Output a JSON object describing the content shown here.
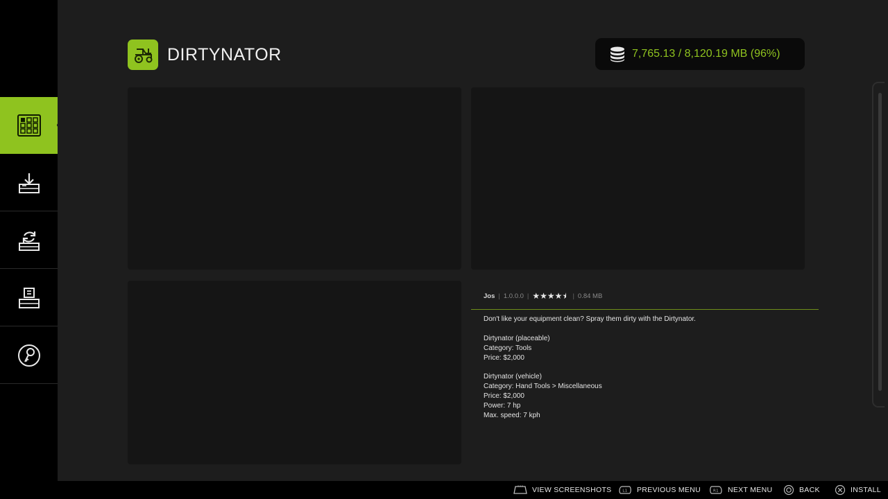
{
  "header": {
    "title": "DIRTYNATOR",
    "storage": "7,765.13 / 8,120.19 MB (96%)"
  },
  "sidebar": {
    "items": [
      {
        "name": "grid-icon",
        "active": true
      },
      {
        "name": "download-icon",
        "active": false
      },
      {
        "name": "update-icon",
        "active": false
      },
      {
        "name": "installed-icon",
        "active": false
      },
      {
        "name": "key-icon",
        "active": false
      }
    ]
  },
  "mod": {
    "author": "Jos",
    "version": "1.0.0.0",
    "rating": 4.5,
    "size": "0.84 MB",
    "description_lines": [
      "Don't like your equipment clean? Spray them dirty with the Dirtynator.",
      "",
      "Dirtynator (placeable)",
      "Category: Tools",
      "Price: $2,000",
      "",
      "Dirtynator (vehicle)",
      "Category: Hand Tools > Miscellaneous",
      "Price: $2,000",
      "Power: 7 hp",
      "Max. speed: 7 kph"
    ]
  },
  "footer": {
    "view_screenshots": "VIEW SCREENSHOTS",
    "previous_menu": "PREVIOUS MENU",
    "next_menu": "NEXT MENU",
    "back": "BACK",
    "install": "INSTALL",
    "l1": "L1",
    "r1": "R1"
  },
  "colors": {
    "accent": "#8fc31f",
    "background": "#1d1d1d",
    "sidebar": "#000000"
  }
}
